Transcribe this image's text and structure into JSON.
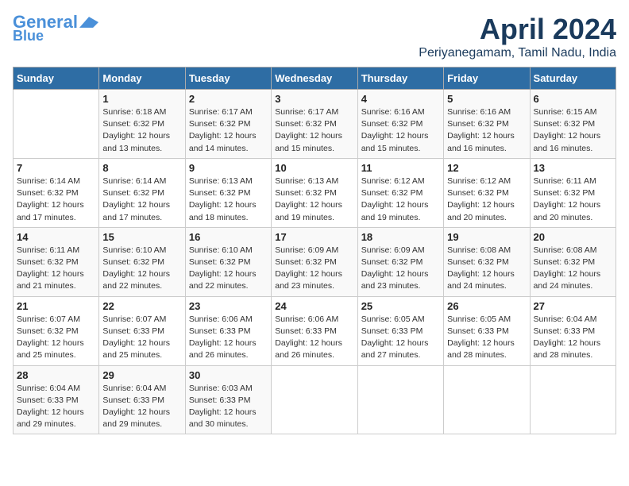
{
  "logo": {
    "line1": "General",
    "line2": "Blue"
  },
  "title": "April 2024",
  "location": "Periyanegamam, Tamil Nadu, India",
  "days_header": [
    "Sunday",
    "Monday",
    "Tuesday",
    "Wednesday",
    "Thursday",
    "Friday",
    "Saturday"
  ],
  "weeks": [
    [
      {
        "day": "",
        "info": ""
      },
      {
        "day": "1",
        "info": "Sunrise: 6:18 AM\nSunset: 6:32 PM\nDaylight: 12 hours\nand 13 minutes."
      },
      {
        "day": "2",
        "info": "Sunrise: 6:17 AM\nSunset: 6:32 PM\nDaylight: 12 hours\nand 14 minutes."
      },
      {
        "day": "3",
        "info": "Sunrise: 6:17 AM\nSunset: 6:32 PM\nDaylight: 12 hours\nand 15 minutes."
      },
      {
        "day": "4",
        "info": "Sunrise: 6:16 AM\nSunset: 6:32 PM\nDaylight: 12 hours\nand 15 minutes."
      },
      {
        "day": "5",
        "info": "Sunrise: 6:16 AM\nSunset: 6:32 PM\nDaylight: 12 hours\nand 16 minutes."
      },
      {
        "day": "6",
        "info": "Sunrise: 6:15 AM\nSunset: 6:32 PM\nDaylight: 12 hours\nand 16 minutes."
      }
    ],
    [
      {
        "day": "7",
        "info": "Sunrise: 6:14 AM\nSunset: 6:32 PM\nDaylight: 12 hours\nand 17 minutes."
      },
      {
        "day": "8",
        "info": "Sunrise: 6:14 AM\nSunset: 6:32 PM\nDaylight: 12 hours\nand 17 minutes."
      },
      {
        "day": "9",
        "info": "Sunrise: 6:13 AM\nSunset: 6:32 PM\nDaylight: 12 hours\nand 18 minutes."
      },
      {
        "day": "10",
        "info": "Sunrise: 6:13 AM\nSunset: 6:32 PM\nDaylight: 12 hours\nand 19 minutes."
      },
      {
        "day": "11",
        "info": "Sunrise: 6:12 AM\nSunset: 6:32 PM\nDaylight: 12 hours\nand 19 minutes."
      },
      {
        "day": "12",
        "info": "Sunrise: 6:12 AM\nSunset: 6:32 PM\nDaylight: 12 hours\nand 20 minutes."
      },
      {
        "day": "13",
        "info": "Sunrise: 6:11 AM\nSunset: 6:32 PM\nDaylight: 12 hours\nand 20 minutes."
      }
    ],
    [
      {
        "day": "14",
        "info": "Sunrise: 6:11 AM\nSunset: 6:32 PM\nDaylight: 12 hours\nand 21 minutes."
      },
      {
        "day": "15",
        "info": "Sunrise: 6:10 AM\nSunset: 6:32 PM\nDaylight: 12 hours\nand 22 minutes."
      },
      {
        "day": "16",
        "info": "Sunrise: 6:10 AM\nSunset: 6:32 PM\nDaylight: 12 hours\nand 22 minutes."
      },
      {
        "day": "17",
        "info": "Sunrise: 6:09 AM\nSunset: 6:32 PM\nDaylight: 12 hours\nand 23 minutes."
      },
      {
        "day": "18",
        "info": "Sunrise: 6:09 AM\nSunset: 6:32 PM\nDaylight: 12 hours\nand 23 minutes."
      },
      {
        "day": "19",
        "info": "Sunrise: 6:08 AM\nSunset: 6:32 PM\nDaylight: 12 hours\nand 24 minutes."
      },
      {
        "day": "20",
        "info": "Sunrise: 6:08 AM\nSunset: 6:32 PM\nDaylight: 12 hours\nand 24 minutes."
      }
    ],
    [
      {
        "day": "21",
        "info": "Sunrise: 6:07 AM\nSunset: 6:32 PM\nDaylight: 12 hours\nand 25 minutes."
      },
      {
        "day": "22",
        "info": "Sunrise: 6:07 AM\nSunset: 6:33 PM\nDaylight: 12 hours\nand 25 minutes."
      },
      {
        "day": "23",
        "info": "Sunrise: 6:06 AM\nSunset: 6:33 PM\nDaylight: 12 hours\nand 26 minutes."
      },
      {
        "day": "24",
        "info": "Sunrise: 6:06 AM\nSunset: 6:33 PM\nDaylight: 12 hours\nand 26 minutes."
      },
      {
        "day": "25",
        "info": "Sunrise: 6:05 AM\nSunset: 6:33 PM\nDaylight: 12 hours\nand 27 minutes."
      },
      {
        "day": "26",
        "info": "Sunrise: 6:05 AM\nSunset: 6:33 PM\nDaylight: 12 hours\nand 28 minutes."
      },
      {
        "day": "27",
        "info": "Sunrise: 6:04 AM\nSunset: 6:33 PM\nDaylight: 12 hours\nand 28 minutes."
      }
    ],
    [
      {
        "day": "28",
        "info": "Sunrise: 6:04 AM\nSunset: 6:33 PM\nDaylight: 12 hours\nand 29 minutes."
      },
      {
        "day": "29",
        "info": "Sunrise: 6:04 AM\nSunset: 6:33 PM\nDaylight: 12 hours\nand 29 minutes."
      },
      {
        "day": "30",
        "info": "Sunrise: 6:03 AM\nSunset: 6:33 PM\nDaylight: 12 hours\nand 30 minutes."
      },
      {
        "day": "",
        "info": ""
      },
      {
        "day": "",
        "info": ""
      },
      {
        "day": "",
        "info": ""
      },
      {
        "day": "",
        "info": ""
      }
    ]
  ]
}
